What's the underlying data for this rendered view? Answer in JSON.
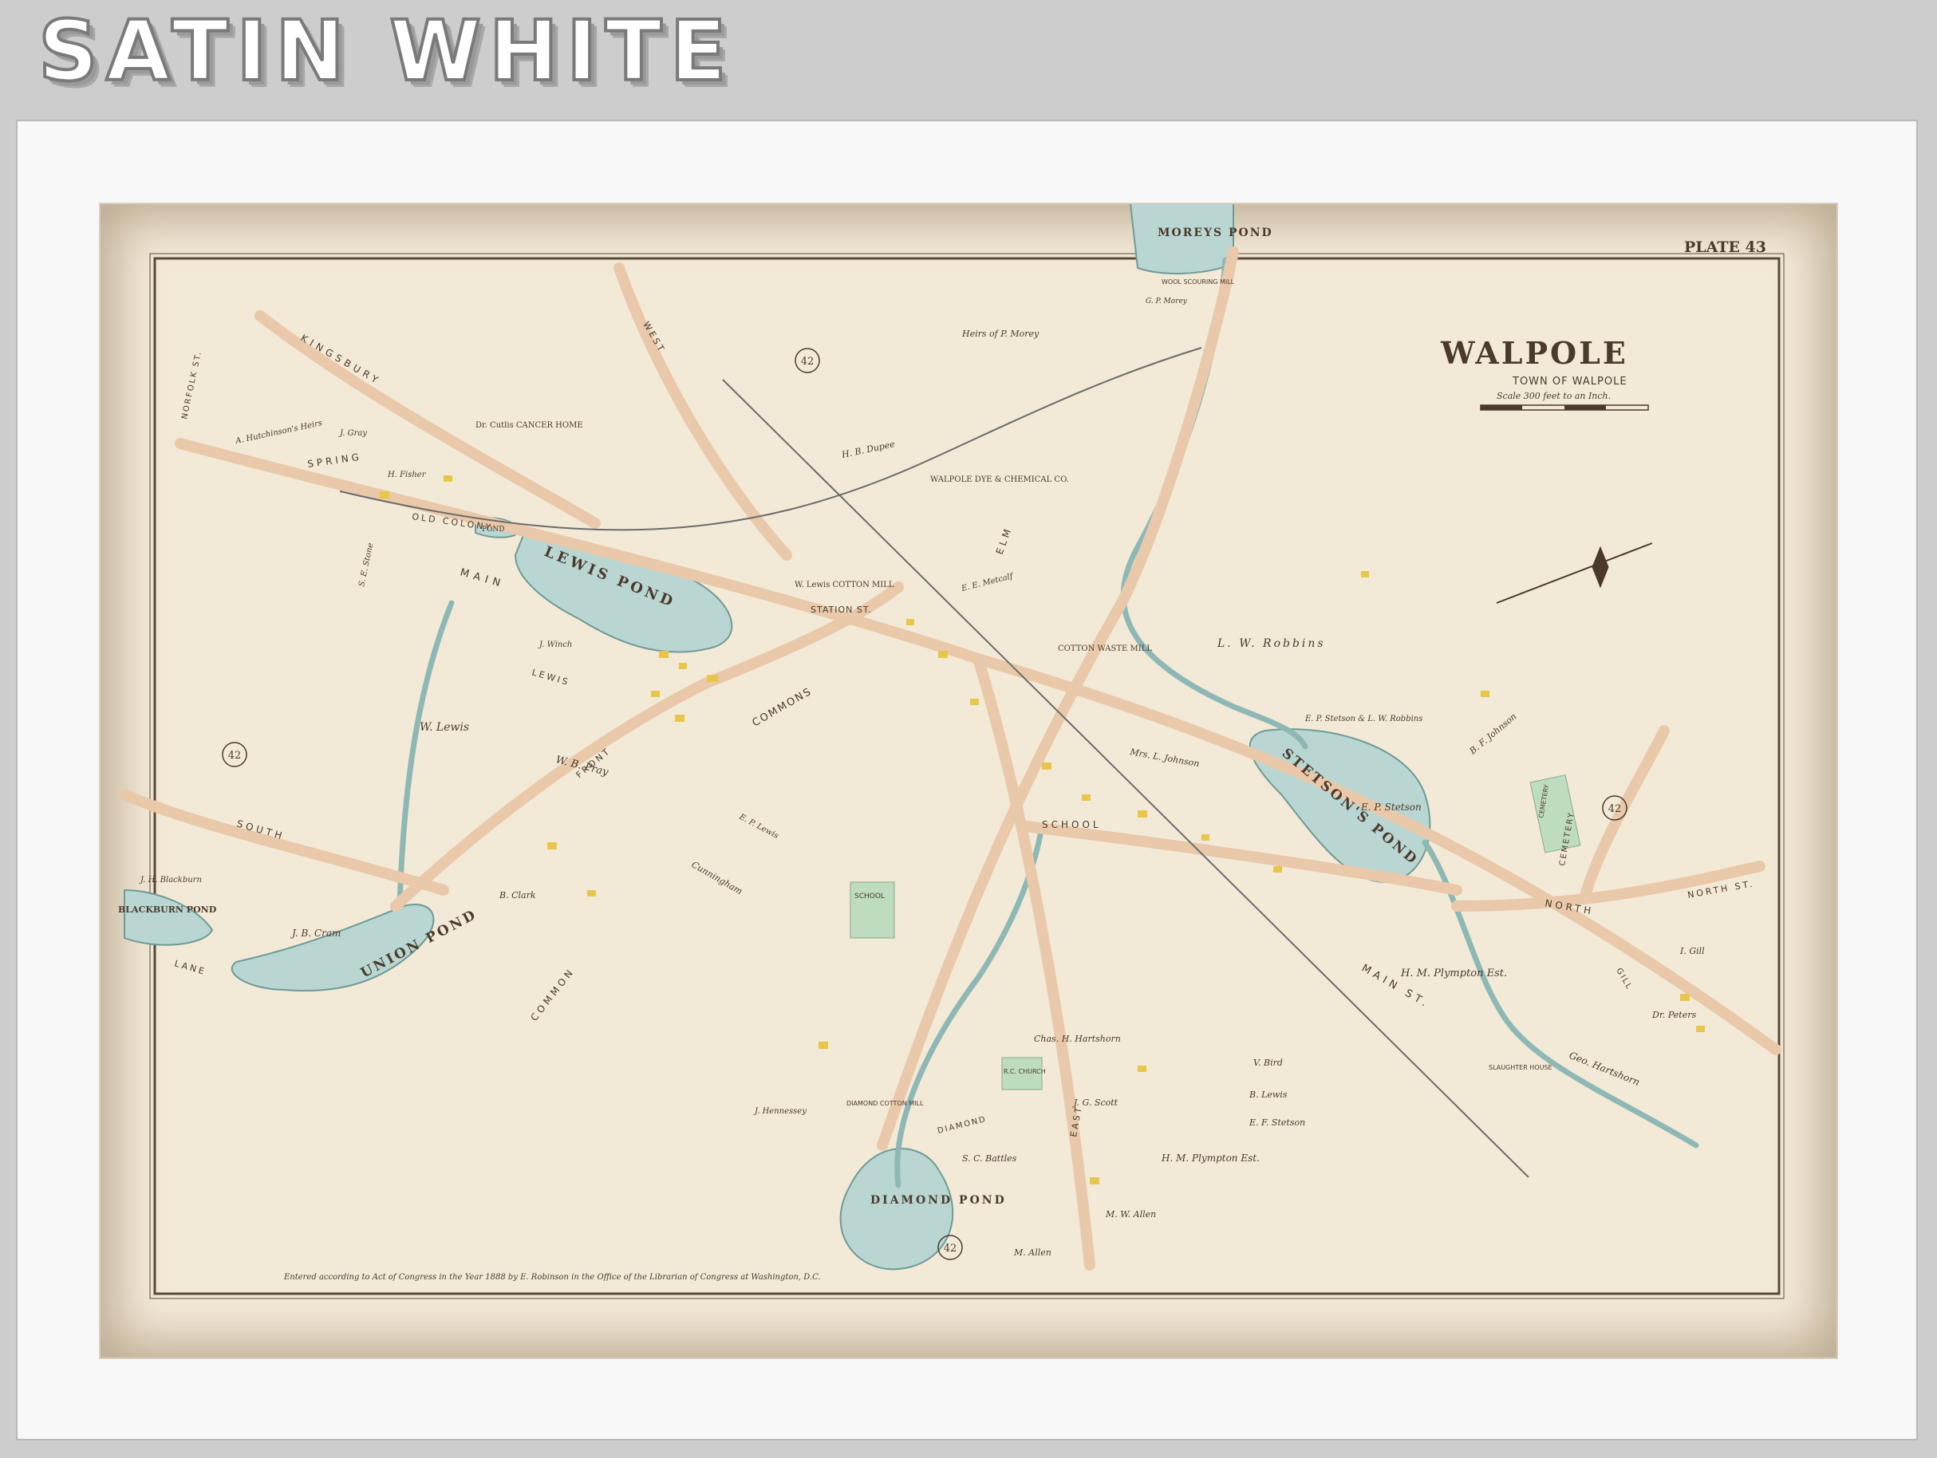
{
  "banner": {
    "text": "SATIN WHITE"
  },
  "map": {
    "plate": "PLATE 43",
    "title": "WALPOLE",
    "subtitle": "TOWN OF WALPOLE",
    "scale_text": "Scale 300 feet to an Inch.",
    "copyright": "Entered according to Act of Congress in the Year 1888 by E. Robinson in the Office of the Librarian of Congress at Washington, D.C.",
    "adjoining_plate": "42",
    "ponds": {
      "lewis": "LEWIS POND",
      "union": "UNION POND",
      "diamond": "DIAMOND POND",
      "stetsons": "STETSON'S POND",
      "moreys": "MOREYS POND",
      "blackburn": "BLACKBURN POND",
      "small": "POND"
    },
    "streets": {
      "main": "MAIN",
      "main_st": "MAIN ST.",
      "kingsbury": "KINGSBURY",
      "spring": "SPRING",
      "old_colony": "OLD COLONY",
      "south": "SOUTH",
      "lane": "LANE",
      "common": "COMMON",
      "school": "SCHOOL",
      "north": "NORTH",
      "north_st": "NORTH ST.",
      "elm": "ELM",
      "east": "EAST",
      "west": "WEST",
      "station": "STATION ST.",
      "front": "FRONT",
      "diamond": "DIAMOND",
      "cemetery": "CEMETERY",
      "norfolk": "NORFOLK ST.",
      "lewis": "LEWIS",
      "gill": "GILL",
      "st": "ST."
    },
    "places": {
      "cotton_mill": "W. Lewis COTTON MILL",
      "cotton_waste": "COTTON WASTE MILL",
      "dye_works": "WALPOLE DYE & CHEMICAL CO.",
      "cancer_home": "Dr. Cutlis CANCER HOME",
      "school": "SCHOOL",
      "rc_church": "R.C. CHURCH",
      "cemetery": "CEMETERY",
      "wool_mill": "WOOL SCOURING MILL",
      "diamond_mill": "DIAMOND COTTON MILL",
      "slaughter_house": "SLAUGHTER HOUSE",
      "commons": "COMMONS"
    },
    "owners": {
      "w_lewis": "W. Lewis",
      "lw_robbins": "L. W. Robbins",
      "ep_stetson": "E. P. Stetson",
      "hm_plympton": "H. M. Plympton Est.",
      "geo_hartshorn": "Geo. Hartshorn",
      "wb_pray": "W. B. Pray",
      "jb_cram": "J. B. Cram",
      "jh_blackburn": "J. H. Blackburn",
      "sc_battles": "S. C. Battles",
      "mw_allen": "M. W. Allen",
      "m_allen": "M. Allen",
      "i_gill": "I. Gill",
      "dr_peters": "Dr. Peters",
      "bf_johnson": "B. F. Johnson",
      "hb_dupee": "H. B. Dupee",
      "p_morey": "Heirs of P. Morey",
      "gp_morey": "G. P. Morey",
      "hartshorn_jr": "Chas. H. Hartshorn",
      "v_bird": "V. Bird",
      "b_lewis": "B. Lewis",
      "e_f_stetson": "E. F. Stetson",
      "mrs_johnson": "Mrs. L. Johnson",
      "cunningham": "Cunningham",
      "ep_stetson_lw": "E. P. Stetson & L. W. Robbins",
      "ee_metcalf": "E. E. Metcalf",
      "b_clark": "B. Clark",
      "jg_scott": "J. G. Scott",
      "hutchinson": "A. Hutchinson's Heirs",
      "se_stone": "S. E. Stone",
      "j_gray": "J. Gray",
      "h_fisher": "H. Fisher",
      "j_winch": "J. Winch",
      "hennessey": "J. Hennessey",
      "ep_lewis": "E. P. Lewis"
    }
  }
}
